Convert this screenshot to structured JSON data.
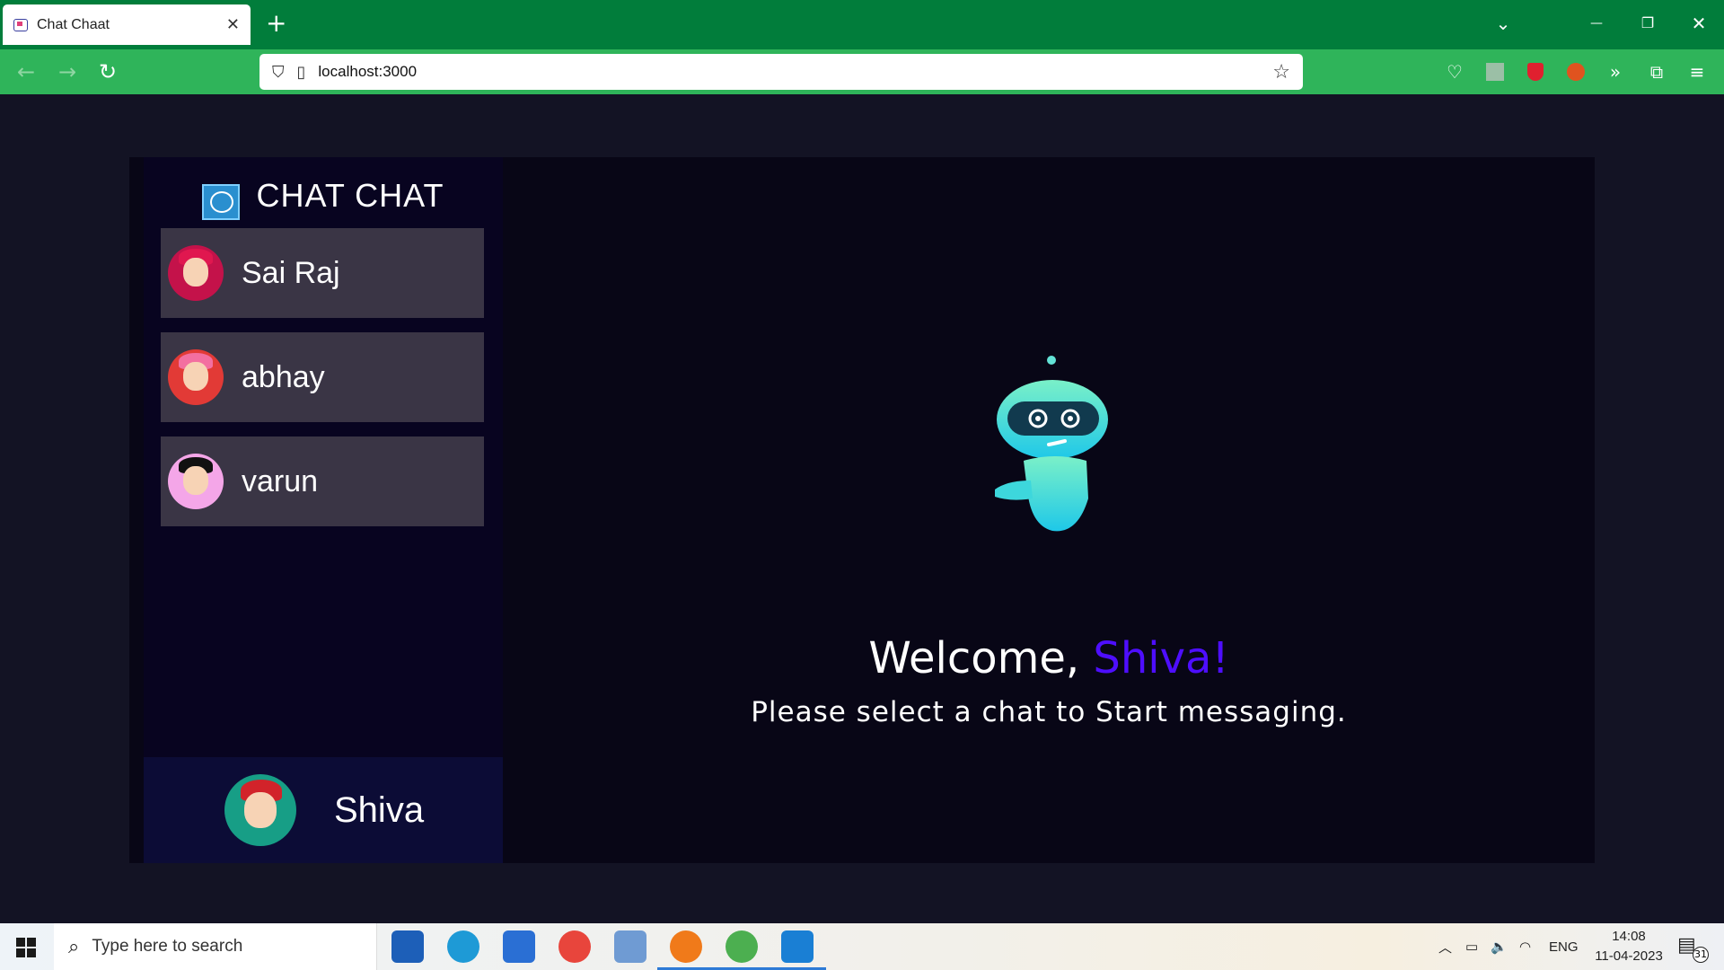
{
  "browser": {
    "tab_title": "Chat Chaat",
    "tab_close": "✕",
    "new_tab": "+",
    "url": "localhost:3000",
    "win_controls": {
      "list": "⌄",
      "minimize": "—",
      "restore": "❐",
      "close": "✕"
    }
  },
  "app": {
    "brand": "CHAT CHAT",
    "contacts": [
      {
        "name": "Sai Raj",
        "avatar_bg": "#c4124a",
        "hair": "#e0174f"
      },
      {
        "name": "abhay",
        "avatar_bg": "#e23a36",
        "hair": "#f36fa0"
      },
      {
        "name": "varun",
        "avatar_bg": "#f4a6e8",
        "hair": "#111111"
      }
    ],
    "current_user": {
      "name": "Shiva",
      "avatar_bg": "#179e86",
      "hair": "#d2232a"
    },
    "welcome": {
      "prefix": "Welcome, ",
      "username": "Shiva!",
      "subtitle": "Please select a chat to Start messaging."
    },
    "colors": {
      "accent": "#4e0eff",
      "background": "#131324",
      "contact_bg": "#3a3545"
    }
  },
  "taskbar": {
    "search_placeholder": "Type here to search",
    "language": "ENG",
    "time": "14:08",
    "date": "11-04-2023",
    "notification_count": "31"
  }
}
